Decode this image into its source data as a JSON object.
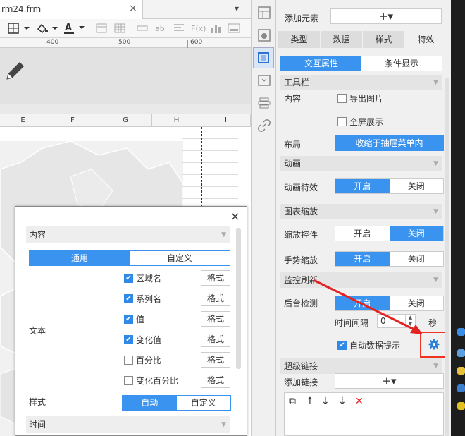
{
  "editor": {
    "file_tab": "rm24.frm",
    "close_glyph": "×",
    "tab_menu_glyph": "▾",
    "toolbar": {
      "bold_ab": "ab",
      "fx": "F(x)"
    },
    "ruler": [
      "400",
      "500",
      "600"
    ],
    "columns": [
      "E",
      "F",
      "G",
      "H",
      "I"
    ]
  },
  "dialog": {
    "close": "×",
    "content_section": "内容",
    "tabs": {
      "general": "通用",
      "custom": "自定义"
    },
    "text_label": "文本",
    "options": [
      {
        "label": "区域名",
        "checked": true,
        "format": "格式"
      },
      {
        "label": "系列名",
        "checked": true,
        "format": "格式"
      },
      {
        "label": "值",
        "checked": true,
        "format": "格式"
      },
      {
        "label": "变化值",
        "checked": true,
        "format": "格式"
      },
      {
        "label": "百分比",
        "checked": false,
        "format": "格式"
      },
      {
        "label": "变化百分比",
        "checked": false,
        "format": "格式"
      }
    ],
    "style_label": "样式",
    "style_auto": "自动",
    "style_custom": "自定义",
    "time_section": "时间"
  },
  "panel": {
    "add_element": "添加元素",
    "plus": "+▾",
    "tabs": [
      "类型",
      "数据",
      "样式",
      "特效"
    ],
    "subtabs": {
      "interaction": "交互属性",
      "condition": "条件显示"
    },
    "toolbar_section": "工具栏",
    "content_label": "内容",
    "export_image": "导出图片",
    "fullscreen": "全屏展示",
    "layout_label": "布局",
    "layout_value": "收缩于抽屉菜单内",
    "animation_section": "动画",
    "animation_effect": "动画特效",
    "on": "开启",
    "off": "关闭",
    "zoom_section": "图表缩放",
    "zoom_control": "缩放控件",
    "gesture_zoom": "手势缩放",
    "monitor_section": "监控刷新",
    "backend_check": "后台检测",
    "interval_label": "时间间隔",
    "interval_value": "0",
    "seconds": "秒",
    "auto_tip": "自动数据提示",
    "hyperlink_section": "超级链接",
    "add_link": "添加链接"
  },
  "colors": {
    "accent": "#3a93ee",
    "highlight": "#e32222"
  }
}
